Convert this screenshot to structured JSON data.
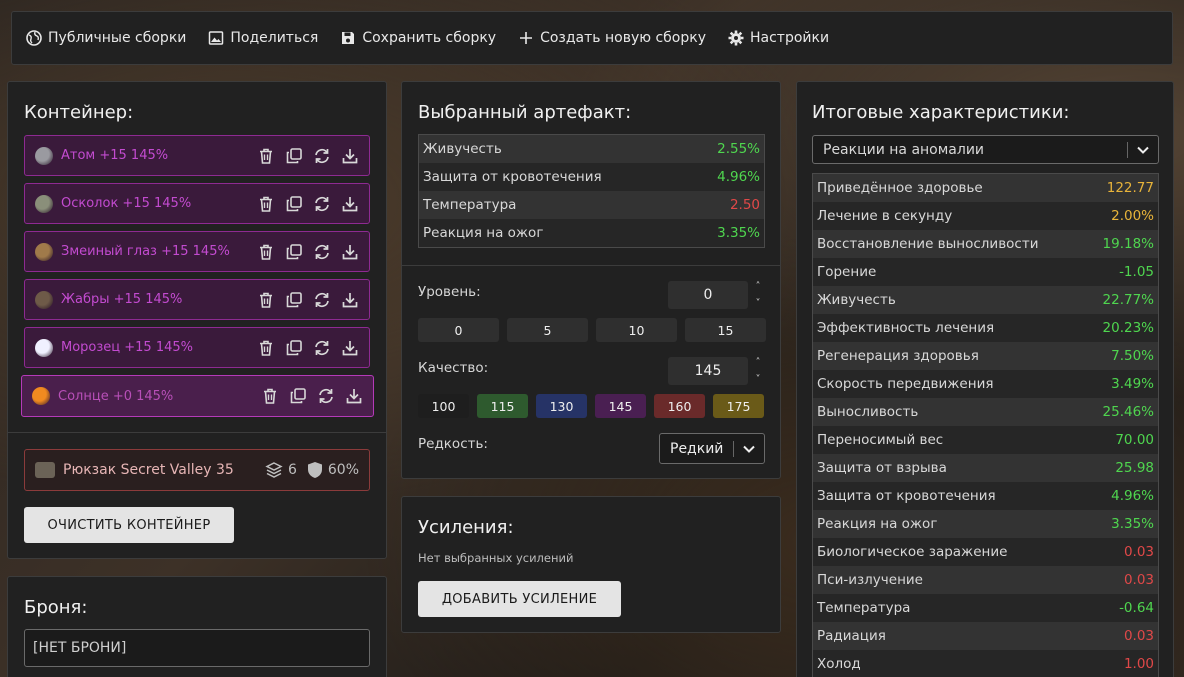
{
  "toolbar": {
    "public_builds": "Публичные сборки",
    "share": "Поделиться",
    "save_build": "Сохранить сборку",
    "create_build": "Создать новую сборку",
    "settings": "Настройки"
  },
  "container": {
    "title": "Контейнер:",
    "artifacts": [
      {
        "name": "Атом +15 145%",
        "thumb_color": "#9a9aa0"
      },
      {
        "name": "Осколок +15 145%",
        "thumb_color": "#8a8f7a"
      },
      {
        "name": "Змеиный глаз +15 145%",
        "thumb_color": "#a07a4a"
      },
      {
        "name": "Жабры +15 145%",
        "thumb_color": "#6e5a48"
      },
      {
        "name": "Морозец +15 145%",
        "thumb_color": "#f0f0ff"
      },
      {
        "name": "Солнце +0 145%",
        "thumb_color": "#f08a20"
      }
    ],
    "backpack": {
      "name": "Рюкзак Secret Valley 35",
      "slots": "6",
      "protection": "60%"
    },
    "clear_button": "ОЧИСТИТЬ КОНТЕЙНЕР"
  },
  "armor": {
    "title": "Броня:",
    "value": "[НЕТ БРОНИ]"
  },
  "artifact": {
    "title": "Выбранный артефакт:",
    "stats": [
      {
        "label": "Живучесть",
        "value": "2.55%",
        "color": "green"
      },
      {
        "label": "Защита от кровотечения",
        "value": "4.96%",
        "color": "green"
      },
      {
        "label": "Температура",
        "value": "2.50",
        "color": "red"
      },
      {
        "label": "Реакция на ожог",
        "value": "3.35%",
        "color": "green"
      }
    ],
    "level_label": "Уровень:",
    "level_value": "0",
    "level_presets": [
      "0",
      "5",
      "10",
      "15"
    ],
    "quality_label": "Качество:",
    "quality_value": "145",
    "quality_presets": [
      {
        "label": "100",
        "color": "#1e1e1e"
      },
      {
        "label": "115",
        "color": "#2e5a2e"
      },
      {
        "label": "130",
        "color": "#263366"
      },
      {
        "label": "145",
        "color": "#4a1f52"
      },
      {
        "label": "160",
        "color": "#6a2a2a"
      },
      {
        "label": "175",
        "color": "#6a5a18"
      }
    ],
    "rarity_label": "Редкость:",
    "rarity_value": "Редкий"
  },
  "boosts": {
    "title": "Усиления:",
    "empty_text": "Нет выбранных усилений",
    "add_button": "ДОБАВИТЬ УСИЛЕНИЕ"
  },
  "totals": {
    "title": "Итоговые характеристики:",
    "filter_value": "Реакции на аномалии",
    "stats": [
      {
        "label": "Приведённое здоровье",
        "value": "122.77",
        "color": "orange"
      },
      {
        "label": "Лечение в секунду",
        "value": "2.00%",
        "color": "orange"
      },
      {
        "label": "Восстановление выносливости",
        "value": "19.18%",
        "color": "green"
      },
      {
        "label": "Горение",
        "value": "-1.05",
        "color": "green"
      },
      {
        "label": "Живучесть",
        "value": "22.77%",
        "color": "green"
      },
      {
        "label": "Эффективность лечения",
        "value": "20.23%",
        "color": "green"
      },
      {
        "label": "Регенерация здоровья",
        "value": "7.50%",
        "color": "green"
      },
      {
        "label": "Скорость передвижения",
        "value": "3.49%",
        "color": "green"
      },
      {
        "label": "Выносливость",
        "value": "25.46%",
        "color": "green"
      },
      {
        "label": "Переносимый вес",
        "value": "70.00",
        "color": "green"
      },
      {
        "label": "Защита от взрыва",
        "value": "25.98",
        "color": "green"
      },
      {
        "label": "Защита от кровотечения",
        "value": "4.96%",
        "color": "green"
      },
      {
        "label": "Реакция на ожог",
        "value": "3.35%",
        "color": "green"
      },
      {
        "label": "Биологическое заражение",
        "value": "0.03",
        "color": "red"
      },
      {
        "label": "Пси-излучение",
        "value": "0.03",
        "color": "red"
      },
      {
        "label": "Температура",
        "value": "-0.64",
        "color": "green"
      },
      {
        "label": "Радиация",
        "value": "0.03",
        "color": "red"
      },
      {
        "label": "Холод",
        "value": "1.00",
        "color": "red"
      }
    ]
  }
}
